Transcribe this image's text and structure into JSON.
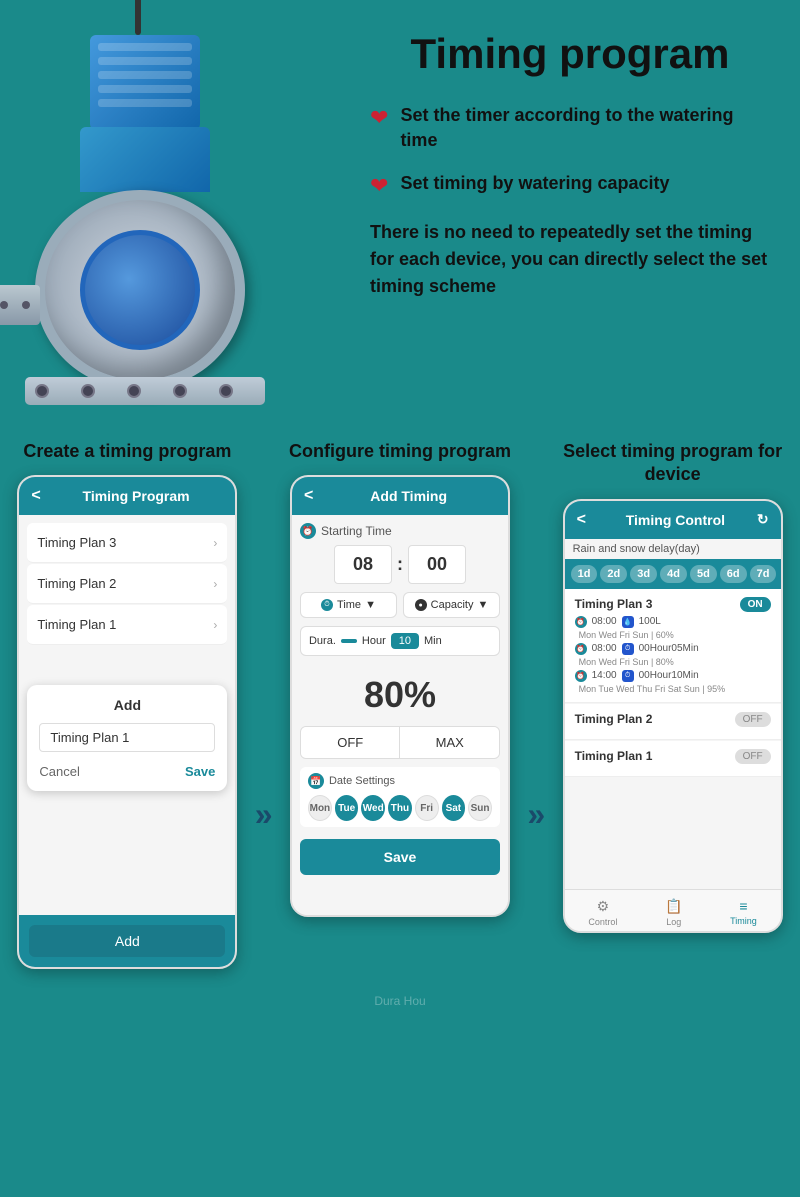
{
  "page": {
    "title": "Timing program",
    "background_color": "#1a8a8a"
  },
  "header": {
    "title": "Timing program",
    "bullet1": "Set the timer according to the watering time",
    "bullet2": "Set timing by watering capacity",
    "description": "There is no need to repeatedly set the timing for each device, you can directly select the set timing scheme"
  },
  "phone1": {
    "label": "Create a timing program",
    "header_title": "Timing Program",
    "list_items": [
      "Timing Plan 3",
      "Timing Plan 2",
      "Timing Plan 1"
    ],
    "dialog_title": "Add",
    "dialog_input_value": "Timing Plan 1",
    "btn_cancel": "Cancel",
    "btn_save": "Save",
    "footer_btn": "Add"
  },
  "phone2": {
    "label": "Configure timing program",
    "header_title": "Add Timing",
    "starting_time_label": "Starting Time",
    "time_hour": "08",
    "time_min": "00",
    "time_selector": "Time",
    "capacity_selector": "Capacity",
    "dura_label": "Dura.",
    "dura_hour": "Hour",
    "dura_min_val": "10",
    "dura_min_label": "Min",
    "percent": "80%",
    "off_label": "OFF",
    "max_label": "MAX",
    "date_settings_label": "Date Settings",
    "days": [
      "Mon",
      "Tue",
      "Wed",
      "Thu",
      "Fri",
      "Sat",
      "Sun"
    ],
    "days_active": [
      false,
      true,
      true,
      true,
      false,
      true,
      false
    ],
    "save_btn": "Save"
  },
  "phone3": {
    "label": "Select timing program for device",
    "header_title": "Timing Control",
    "rain_delay_label": "Rain and snow delay(day)",
    "day_pills": [
      "1d",
      "2d",
      "3d",
      "4d",
      "5d",
      "6d",
      "7d"
    ],
    "plans": [
      {
        "name": "Timing Plan 3",
        "toggle": "ON",
        "toggle_active": true,
        "details": [
          {
            "time": "08:00",
            "value": "100L",
            "days": "Mon Wed Fri Sun | 60%"
          },
          {
            "time": "08:00",
            "value": "00Hour05Min",
            "days": "Mon Wed Fri Sun | 80%"
          },
          {
            "time": "14:00",
            "value": "00Hour10Min",
            "days": "Mon Tue Wed Thu Fri Sat Sun | 95%"
          }
        ]
      },
      {
        "name": "Timing Plan 2",
        "toggle": "OFF",
        "toggle_active": false,
        "details": []
      },
      {
        "name": "Timing Plan 1",
        "toggle": "OFF",
        "toggle_active": false,
        "details": []
      }
    ],
    "footer_items": [
      "Control",
      "Log",
      "Timing"
    ],
    "footer_active": "Timing"
  },
  "watermark": "Dura Hou"
}
